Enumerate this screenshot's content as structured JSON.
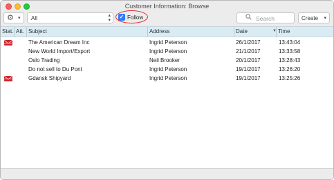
{
  "window": {
    "title": "Customer Information: Browse"
  },
  "toolbar": {
    "gear_icon": "gear-icon",
    "filter_value": "All",
    "follow_label": "Follow",
    "follow_checked": true,
    "search_placeholder": "Search",
    "create_label": "Create"
  },
  "columns": [
    "Stat.",
    "Att.",
    "Subject",
    "Address",
    "Date",
    "Time"
  ],
  "rows": [
    {
      "status_icon": "mail-unread-icon",
      "subject": "The American Dream Inc",
      "address": "Ingrid Peterson",
      "date": "26/1/2017",
      "time": "13:43:04"
    },
    {
      "status_icon": "",
      "subject": "New World Import/Export",
      "address": "Ingrid Peterson",
      "date": "21/1/2017",
      "time": "13:33:58"
    },
    {
      "status_icon": "",
      "subject": "Oslo Trading",
      "address": "Neil Brooker",
      "date": "20/1/2017",
      "time": "13:28:43"
    },
    {
      "status_icon": "",
      "subject": "Do not sell to Du Pont",
      "address": "Ingrid Peterson",
      "date": "19/1/2017",
      "time": "13:26:20"
    },
    {
      "status_icon": "mail-unread-icon",
      "subject": "Gdansk Shipyard",
      "address": "Ingrid Peterson",
      "date": "19/1/2017",
      "time": "13:25:26"
    }
  ],
  "colors": {
    "header_bg": "#d9ecf4",
    "follow_highlight": "#e3232a",
    "mail_icon": "#c6262e",
    "checkbox": "#2f7cf6"
  }
}
